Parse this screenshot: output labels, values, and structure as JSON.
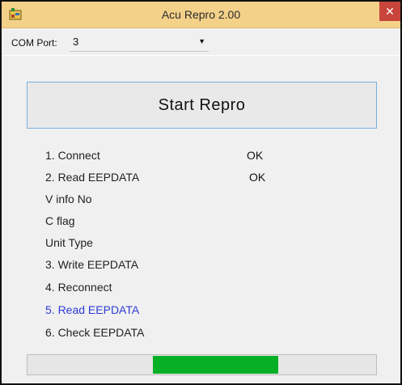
{
  "window": {
    "title": "Acu Repro 2.00",
    "close_glyph": "✕",
    "icon": "app-icon",
    "colors": {
      "titlebar": "#f4d189",
      "close": "#c8453c"
    }
  },
  "com_port": {
    "label": "COM Port:",
    "value": "3"
  },
  "start_button": {
    "label": "Start Repro"
  },
  "steps": [
    {
      "label": "1. Connect",
      "result": "OK"
    },
    {
      "label": "2. Read EEPDATA",
      "result": "OK"
    },
    {
      "label": "V info No",
      "result": ""
    },
    {
      "label": "C flag",
      "result": ""
    },
    {
      "label": "Unit Type",
      "result": ""
    },
    {
      "label": "3. Write EEPDATA",
      "result": ""
    },
    {
      "label": "4. Reconnect",
      "result": ""
    },
    {
      "label": "5. Read EEPDATA",
      "result": "",
      "active": true
    },
    {
      "label": "6. Check EEPDATA",
      "result": ""
    }
  ],
  "colors": {
    "active_step": "#2e3bd9",
    "progress": "#06b025"
  },
  "progress": {
    "start_fraction": 0.36,
    "end_fraction": 0.72
  }
}
